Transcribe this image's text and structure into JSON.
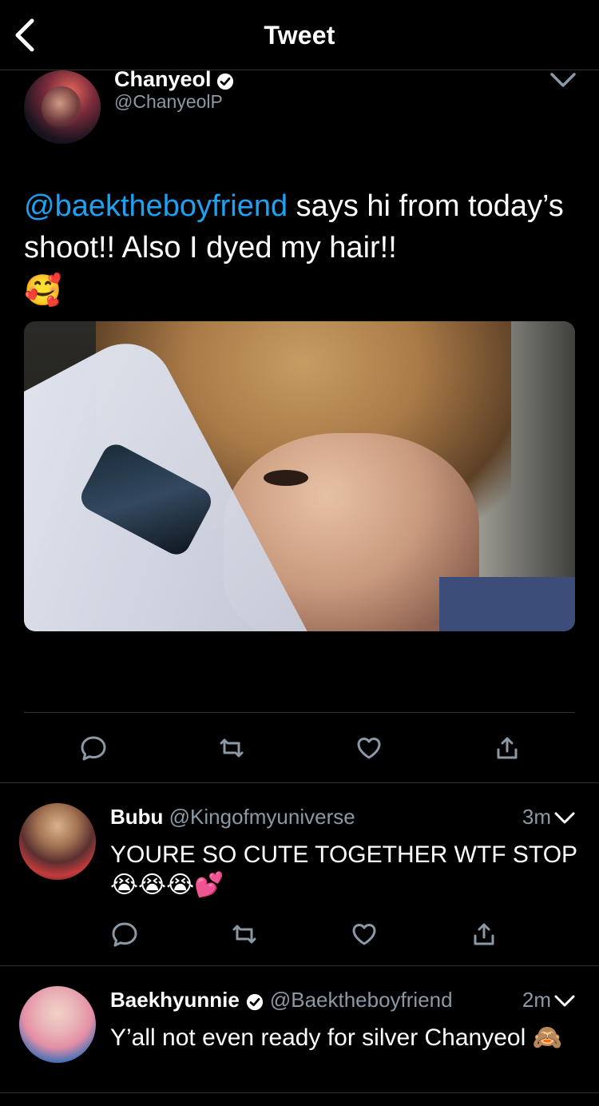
{
  "topbar": {
    "title": "Tweet"
  },
  "main_tweet": {
    "author_name": "Chanyeol",
    "author_handle": "@ChanyeolP",
    "mention": "@baektheboyfriend",
    "text_part1": " says hi from today’s shoot!! Also I dyed my hair!!",
    "emoji": "🥰"
  },
  "replies": [
    {
      "name": "Bubu",
      "handle": "@Kingofmyuniverse",
      "time": "3m",
      "text": "YOURE SO CUTE TOGETHER WTF STOP 😭😭😭💕"
    },
    {
      "name": "Baekhyunnie",
      "handle": "@Baektheboyfriend",
      "time": "2m",
      "text": "Y’all not even ready for silver Chanyeol 🙈"
    }
  ],
  "colors": {
    "accent": "#1da1f2",
    "secondary_text": "#8b98a5",
    "divider": "#2f3336",
    "background": "#000000"
  },
  "icons": [
    "back-arrow-icon",
    "verified-icon",
    "chevron-down-icon",
    "reply-icon",
    "retweet-icon",
    "like-icon",
    "share-icon"
  ]
}
